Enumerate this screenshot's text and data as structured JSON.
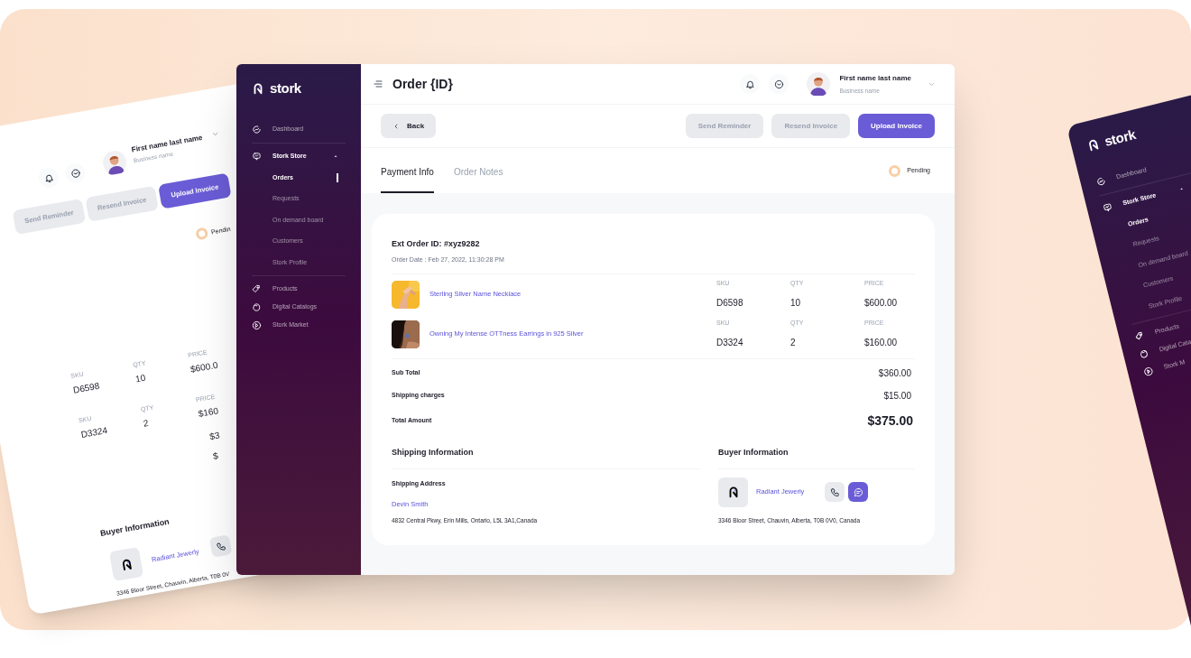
{
  "window": {
    "title": "Order {ID}"
  },
  "sidebar": {
    "logo": "stork",
    "items": [
      {
        "label": "Dashboard"
      },
      {
        "label": "Stork Store",
        "expanded": true,
        "children": [
          {
            "label": "Orders",
            "selected": true
          },
          {
            "label": "Requests",
            "selected": false
          },
          {
            "label": "On demand board",
            "selected": false
          },
          {
            "label": "Customers",
            "selected": false
          },
          {
            "label": "Stork Profile",
            "selected": false
          }
        ]
      },
      {
        "label": "Products"
      },
      {
        "label": "Digital Catalogs"
      },
      {
        "label": "Stork Market"
      }
    ]
  },
  "user": {
    "name": "First name last name",
    "business": "Business name"
  },
  "back_button": "Back",
  "actions": [
    {
      "label": "Send Reminder",
      "kind": "secondary"
    },
    {
      "label": "Resend Invoice",
      "kind": "secondary"
    },
    {
      "label": "Upload Invoice",
      "kind": "primary"
    }
  ],
  "tabs": [
    {
      "label": "Payment Info",
      "selected": true
    },
    {
      "label": "Order Notes",
      "selected": false
    }
  ],
  "status": {
    "label": "Pending",
    "color": "#f8cfa6"
  },
  "order": {
    "ext_id": "Ext Order ID: #xyz9282",
    "date": "Order Date : Feb 27, 2022, 11:30:28 PM",
    "items": [
      {
        "name": "Sterling Silver Name Necklace",
        "sku_label": "SKU",
        "sku": "D6598",
        "qty_label": "QTY",
        "qty": "10",
        "price_label": "PRICE",
        "price": "$600.00"
      },
      {
        "name": "Owning My Intense OTTness Earrings in 925 Silver",
        "sku_label": "SKU",
        "sku": "D3324",
        "qty_label": "QTY",
        "qty": "2",
        "price_label": "PRICE",
        "price": "$160.00"
      }
    ],
    "totals": [
      {
        "label": "Sub Total",
        "value": "$360.00",
        "kind": "line"
      },
      {
        "label": "Shipping charges",
        "value": "$15.00",
        "kind": "line"
      },
      {
        "label": "Total Amount",
        "value": "$375.00",
        "kind": "total"
      }
    ]
  },
  "shipping": {
    "heading": "Shipping Information",
    "address_label": "Shipping Address",
    "name": "Devin Smith",
    "address": "4832 Central Pkwy, Erin Mills, Ontario, L5L 3A1,Canada"
  },
  "buyer": {
    "heading": "Buyer Information",
    "name": "Radiant Jewerly",
    "address": "3346 Bloor Street, Chauvin, Alberta, T0B 0V0, Canada"
  },
  "left_mockup": {
    "user": {
      "name": "First name last name",
      "business": "Business name"
    },
    "actions": [
      {
        "label": "Send Reminder",
        "kind": "secondary"
      },
      {
        "label": "Resend Invoice",
        "kind": "secondary"
      },
      {
        "label": "Upload Invoice",
        "kind": "primary"
      }
    ],
    "status": "Pendin",
    "items": [
      {
        "sku_label": "SKU",
        "sku": "D6598",
        "qty_label": "QTY",
        "qty": "10",
        "price_label": "PRICE",
        "price": "$600.0"
      },
      {
        "sku_label": "SKU",
        "sku": "D3324",
        "qty_label": "QTY",
        "qty": "2",
        "price_label": "PRICE",
        "price": "$160"
      }
    ],
    "totals": [
      "$3",
      "$"
    ],
    "buyer": {
      "heading": "Buyer Information",
      "name": "Radiant Jewerly",
      "address": "3346 Bloor Street, Chauvin, Alberta, T0B 0V"
    }
  },
  "right_mockup": {
    "logo": "stork",
    "items": [
      {
        "label": "Dashboard"
      },
      {
        "label": "Stork Store",
        "expanded": true,
        "children": [
          {
            "label": "Orders",
            "selected": true
          },
          {
            "label": "Requests",
            "selected": false
          },
          {
            "label": "On demand board",
            "selected": false
          },
          {
            "label": "Customers",
            "selected": false
          },
          {
            "label": "Stork Profile",
            "selected": false
          }
        ]
      },
      {
        "label": "Products"
      },
      {
        "label": "Digital Cata"
      },
      {
        "label": "Stork M"
      }
    ]
  }
}
